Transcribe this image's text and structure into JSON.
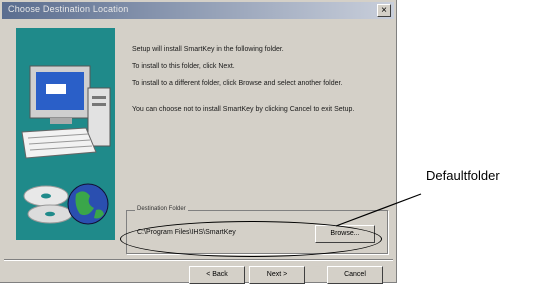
{
  "window": {
    "title": "Choose Destination Location",
    "close_glyph": "×"
  },
  "body_text": {
    "line1": "Setup will install SmartKey in the following folder.",
    "line2": "To install to this folder, click Next.",
    "line3": "To install to a different folder, click Browse and select another folder.",
    "line4": "You can choose not to install SmartKey by clicking Cancel to exit Setup."
  },
  "destination": {
    "group_label": "Destination Folder",
    "path": "C:\\Program Files\\IHS\\SmartKey",
    "browse_label": "Browse..."
  },
  "buttons": {
    "back_label": "< Back",
    "next_label": "Next >",
    "cancel_label": "Cancel"
  },
  "annotation": {
    "label": "Defaultfolder"
  },
  "colors": {
    "dialog_bg": "#d4d0c8",
    "art_bg": "#1f8a8a",
    "title_gradient_start": "#5a6d8f"
  }
}
